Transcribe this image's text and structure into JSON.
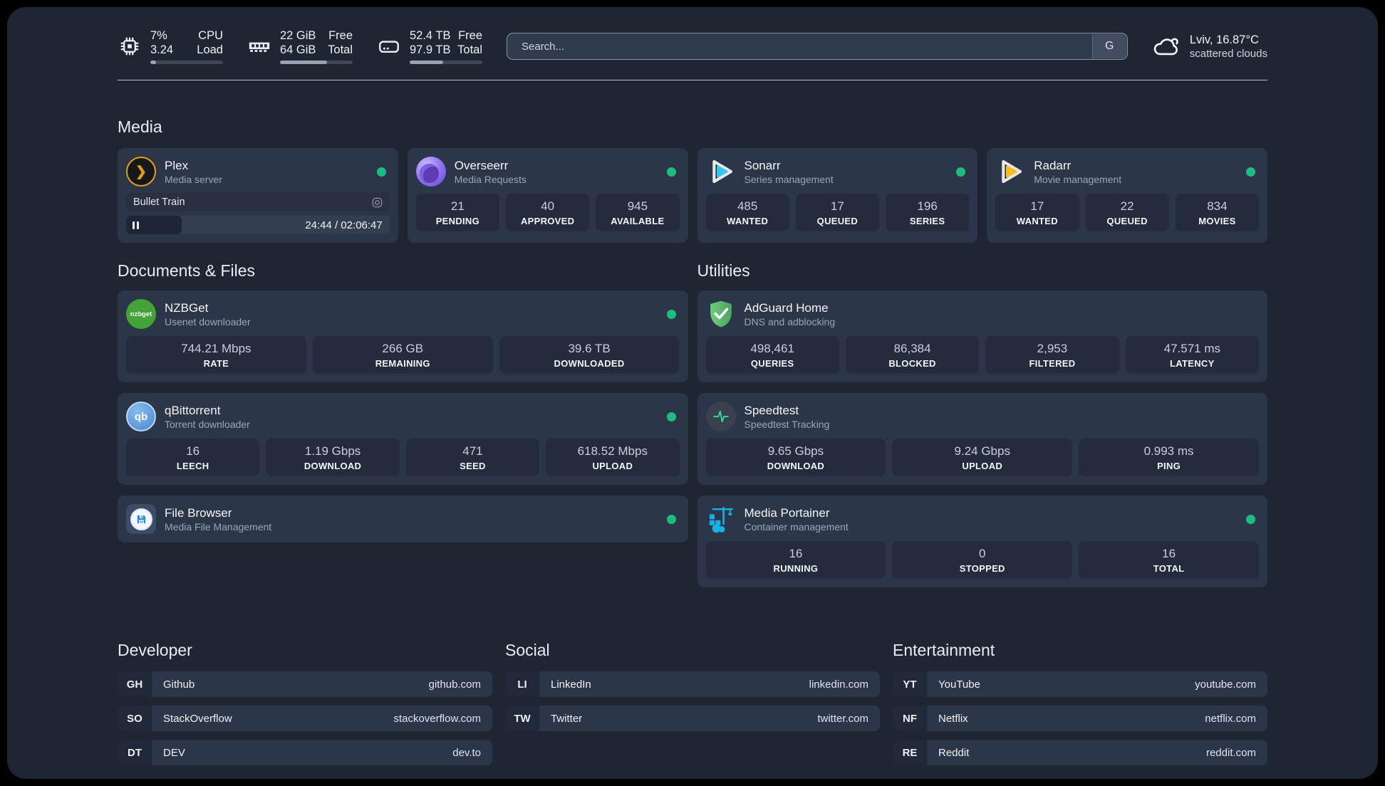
{
  "header": {
    "system_stats": [
      {
        "icon": "cpu-icon",
        "values": [
          "7%",
          "3.24"
        ],
        "labels": [
          "CPU",
          "Load"
        ],
        "progress_pct": 8
      },
      {
        "icon": "ram-icon",
        "values": [
          "22 GiB",
          "64 GiB"
        ],
        "labels": [
          "Free",
          "Total"
        ],
        "progress_pct": 65
      },
      {
        "icon": "disk-icon",
        "values": [
          "52.4 TB",
          "97.9 TB"
        ],
        "labels": [
          "Free",
          "Total"
        ],
        "progress_pct": 46
      }
    ],
    "search": {
      "placeholder": "Search...",
      "engine_button": "G"
    },
    "weather": {
      "location": "Lviv, 16.87°C",
      "condition": "scattered clouds"
    }
  },
  "sections": {
    "media": {
      "title": "Media",
      "plex": {
        "name": "Plex",
        "description": "Media server",
        "online": true,
        "icon_glyph": "❯",
        "now_playing": {
          "title": "Bullet Train",
          "time_display": "24:44 / 02:06:47",
          "progress_pct": 21
        }
      },
      "overseerr": {
        "name": "Overseerr",
        "description": "Media Requests",
        "online": true,
        "stats": [
          {
            "value": "21",
            "label": "PENDING"
          },
          {
            "value": "40",
            "label": "APPROVED"
          },
          {
            "value": "945",
            "label": "AVAILABLE"
          }
        ]
      },
      "sonarr": {
        "name": "Sonarr",
        "description": "Series management",
        "online": true,
        "stats": [
          {
            "value": "485",
            "label": "WANTED"
          },
          {
            "value": "17",
            "label": "QUEUED"
          },
          {
            "value": "196",
            "label": "SERIES"
          }
        ]
      },
      "radarr": {
        "name": "Radarr",
        "description": "Movie management",
        "online": true,
        "stats": [
          {
            "value": "17",
            "label": "WANTED"
          },
          {
            "value": "22",
            "label": "QUEUED"
          },
          {
            "value": "834",
            "label": "MOVIES"
          }
        ]
      }
    },
    "documents": {
      "title": "Documents & Files",
      "nzbget": {
        "name": "NZBGet",
        "description": "Usenet downloader",
        "online": true,
        "icon_text": "nzbget",
        "stats": [
          {
            "value": "744.21 Mbps",
            "label": "RATE"
          },
          {
            "value": "266 GB",
            "label": "REMAINING"
          },
          {
            "value": "39.6 TB",
            "label": "DOWNLOADED"
          }
        ]
      },
      "qbittorrent": {
        "name": "qBittorrent",
        "description": "Torrent downloader",
        "online": true,
        "icon_text": "qb",
        "stats": [
          {
            "value": "16",
            "label": "LEECH"
          },
          {
            "value": "1.19 Gbps",
            "label": "DOWNLOAD"
          },
          {
            "value": "471",
            "label": "SEED"
          },
          {
            "value": "618.52 Mbps",
            "label": "UPLOAD"
          }
        ]
      },
      "filebrowser": {
        "name": "File Browser",
        "description": "Media File Management",
        "online": true
      }
    },
    "utilities": {
      "title": "Utilities",
      "adguard": {
        "name": "AdGuard Home",
        "description": "DNS and adblocking",
        "online": false,
        "stats": [
          {
            "value": "498,461",
            "label": "QUERIES"
          },
          {
            "value": "86,384",
            "label": "BLOCKED"
          },
          {
            "value": "2,953",
            "label": "FILTERED"
          },
          {
            "value": "47.571 ms",
            "label": "LATENCY"
          }
        ]
      },
      "speedtest": {
        "name": "Speedtest",
        "description": "Speedtest Tracking",
        "online": false,
        "stats": [
          {
            "value": "9.65 Gbps",
            "label": "DOWNLOAD"
          },
          {
            "value": "9.24 Gbps",
            "label": "UPLOAD"
          },
          {
            "value": "0.993 ms",
            "label": "PING"
          }
        ]
      },
      "portainer": {
        "name": "Media Portainer",
        "description": "Container management",
        "online": true,
        "stats": [
          {
            "value": "16",
            "label": "RUNNING"
          },
          {
            "value": "0",
            "label": "STOPPED"
          },
          {
            "value": "16",
            "label": "TOTAL"
          }
        ]
      }
    },
    "links": {
      "developer": {
        "title": "Developer",
        "items": [
          {
            "tag": "GH",
            "name": "Github",
            "url": "github.com"
          },
          {
            "tag": "SO",
            "name": "StackOverflow",
            "url": "stackoverflow.com"
          },
          {
            "tag": "DT",
            "name": "DEV",
            "url": "dev.to"
          }
        ]
      },
      "social": {
        "title": "Social",
        "items": [
          {
            "tag": "LI",
            "name": "LinkedIn",
            "url": "linkedin.com"
          },
          {
            "tag": "TW",
            "name": "Twitter",
            "url": "twitter.com"
          }
        ]
      },
      "entertainment": {
        "title": "Entertainment",
        "items": [
          {
            "tag": "YT",
            "name": "YouTube",
            "url": "youtube.com"
          },
          {
            "tag": "NF",
            "name": "Netflix",
            "url": "netflix.com"
          },
          {
            "tag": "RE",
            "name": "Reddit",
            "url": "reddit.com"
          }
        ]
      }
    }
  },
  "colors": {
    "status_online": "#1dbd82",
    "plex_accent": "#e5a00d",
    "sonarr_accent": "#37c6f4",
    "radarr_accent": "#fbbf24",
    "portainer_accent": "#18b1e7",
    "adguard_accent": "#5cb86b",
    "card_bg": "#2b3648",
    "page_bg": "#1e2634"
  }
}
